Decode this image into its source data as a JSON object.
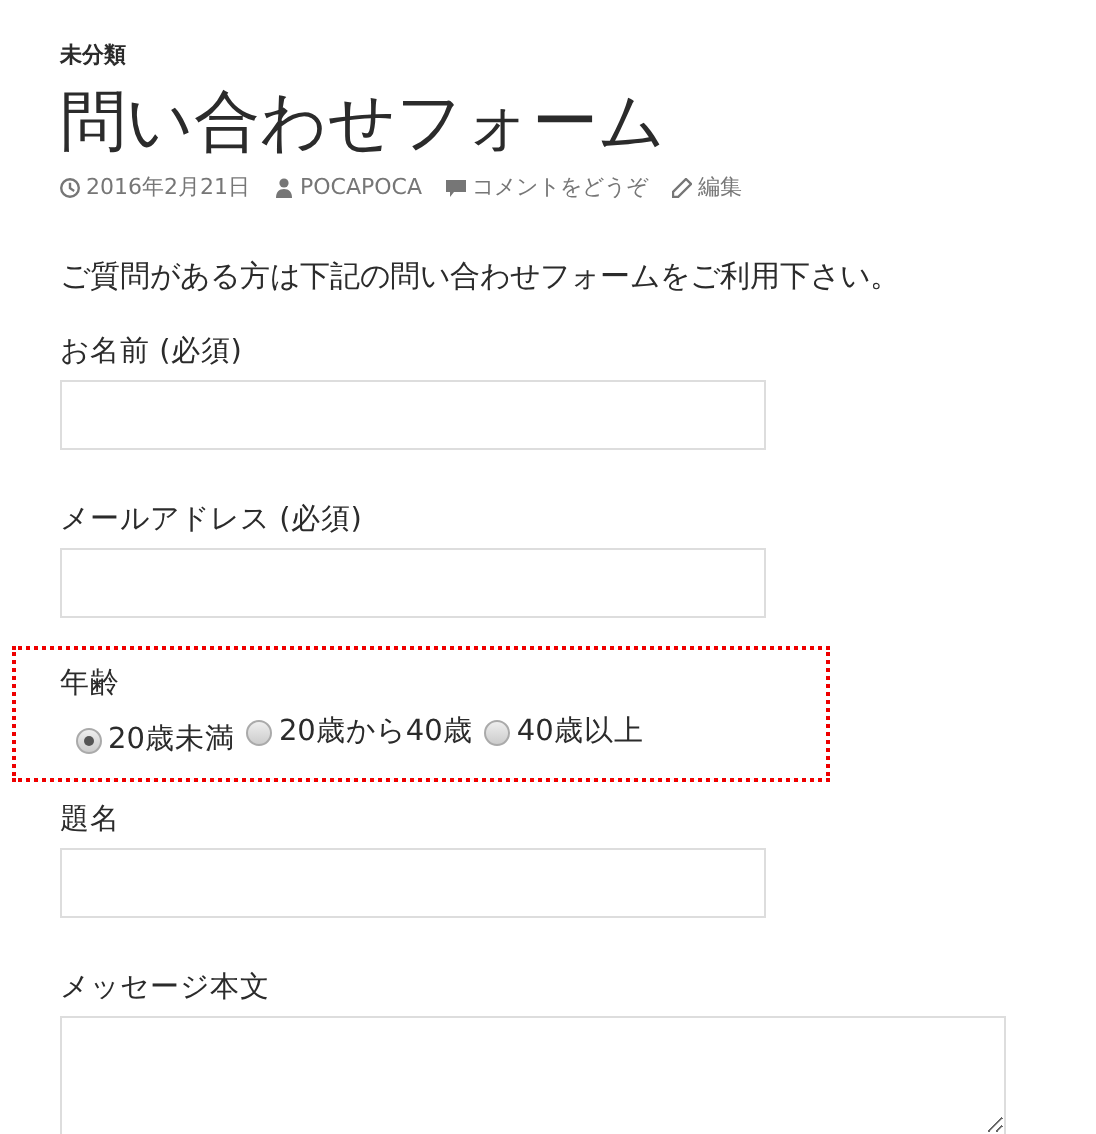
{
  "category": "未分類",
  "title": "問い合わせフォーム",
  "meta": [
    {
      "kind": "date",
      "text": "2016年2月21日"
    },
    {
      "kind": "author",
      "text": "POCAPOCA"
    },
    {
      "kind": "comment",
      "text": "コメントをどうぞ"
    },
    {
      "kind": "edit",
      "text": "編集"
    }
  ],
  "intro": "ご質問がある方は下記の問い合わせフォームをご利用下さい。",
  "fields": [
    {
      "kind": "text",
      "label": "お名前 (必須)",
      "highlighted": false
    },
    {
      "kind": "text",
      "label": "メールアドレス (必須)",
      "highlighted": false
    },
    {
      "kind": "radio",
      "label": "年齢",
      "highlighted": true,
      "options": [
        {
          "label": "20歳未満",
          "selected": true
        },
        {
          "label": "20歳から40歳",
          "selected": false
        },
        {
          "label": "40歳以上",
          "selected": false
        }
      ]
    },
    {
      "kind": "text",
      "label": "題名",
      "highlighted": false
    },
    {
      "kind": "textarea",
      "label": "メッセージ本文",
      "highlighted": false
    }
  ]
}
